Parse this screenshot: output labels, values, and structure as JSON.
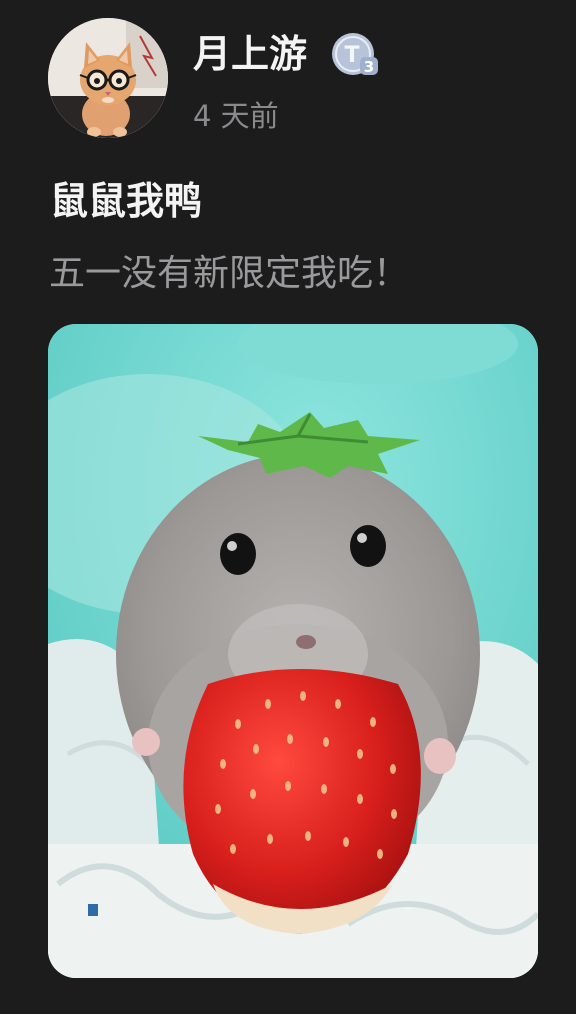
{
  "author": {
    "name": "月上游",
    "level_badge": "T3",
    "avatar_icon": "cat-with-glasses-avatar"
  },
  "post": {
    "timestamp": "4 天前",
    "title": "鼠鼠我鸭",
    "body": "五一没有新限定我吃！",
    "image_icon": "hamster-with-strawberry-photo"
  },
  "colors": {
    "background": "#1c1c1d",
    "title_text": "#f4f4f4",
    "secondary_text": "#8a8a8c",
    "badge": "#b6c2d8"
  }
}
